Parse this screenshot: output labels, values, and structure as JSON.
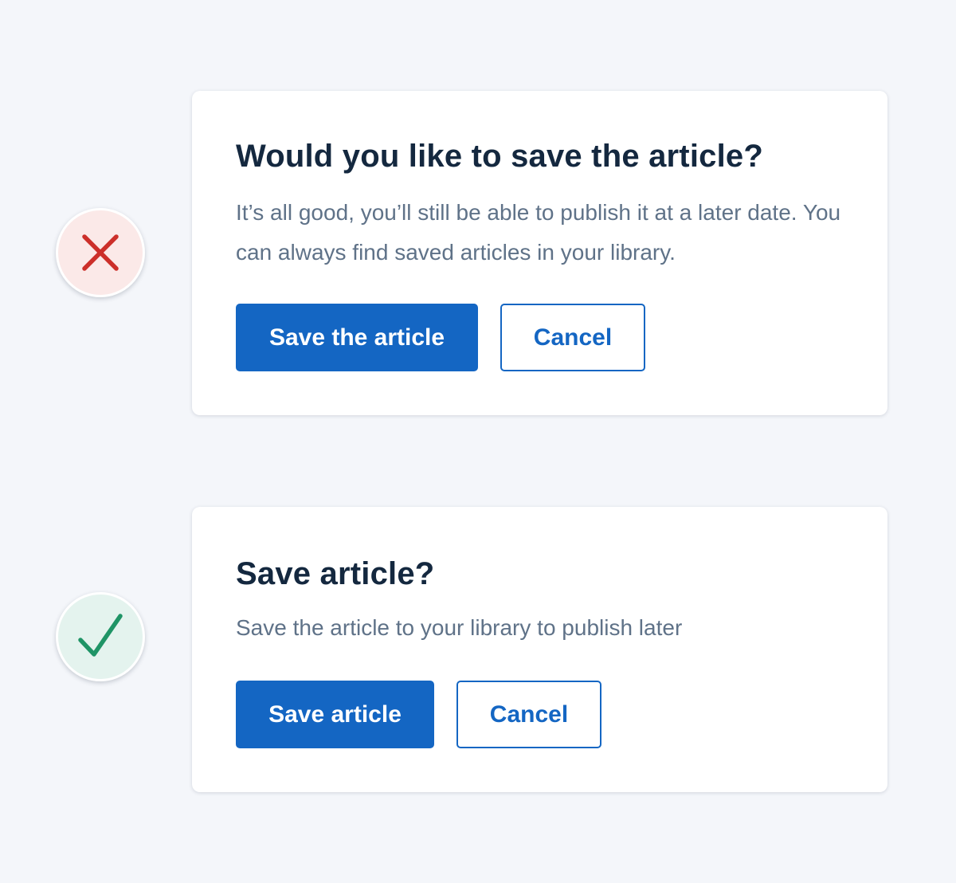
{
  "bad_example": {
    "marker": {
      "icon": "cross-icon",
      "color": "#cc2f2a",
      "background": "#fbe9e8"
    },
    "title": "Would you like to save the article?",
    "body": "It’s all good, you’ll still be able to publish it at a later date. You can always find saved articles in your library.",
    "primary_label": "Save the article",
    "secondary_label": "Cancel"
  },
  "good_example": {
    "marker": {
      "icon": "checkmark-icon",
      "color": "#1f9466",
      "background": "#e4f3ee"
    },
    "title": "Save article?",
    "body": "Save the article to your library to publish later",
    "primary_label": "Save article",
    "secondary_label": "Cancel"
  },
  "colors": {
    "page_background": "#f4f6fa",
    "card_background": "#ffffff",
    "title_text": "#14283f",
    "body_text": "#5f7288",
    "primary_button": "#1466c3",
    "primary_button_text": "#ffffff"
  }
}
